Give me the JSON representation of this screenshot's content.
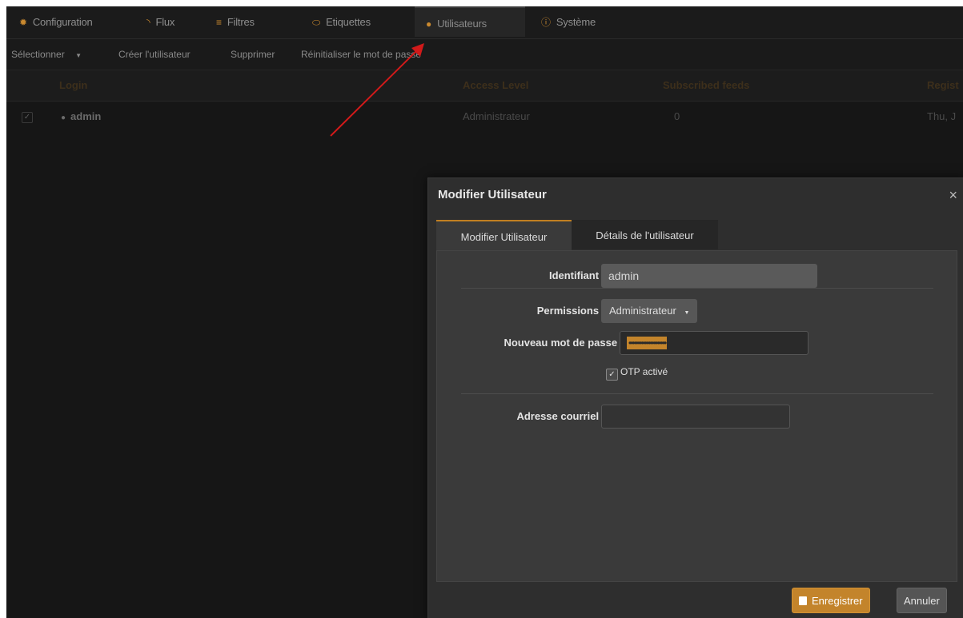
{
  "tabs": [
    {
      "label": "Configuration",
      "icon": "gear-icon"
    },
    {
      "label": "Flux",
      "icon": "rss-icon"
    },
    {
      "label": "Filtres",
      "icon": "filter-icon"
    },
    {
      "label": "Etiquettes",
      "icon": "label-icon"
    },
    {
      "label": "Utilisateurs",
      "icon": "user-icon",
      "active": true
    },
    {
      "label": "Système",
      "icon": "info-icon"
    }
  ],
  "toolbar": {
    "select_label": "Sélectionner",
    "create_label": "Créer l'utilisateur",
    "delete_label": "Supprimer",
    "reset_label": "Réinitialiser le mot de passe"
  },
  "grid": {
    "columns": [
      "Login",
      "Access Level",
      "Subscribed feeds",
      "Regist"
    ],
    "rows": [
      {
        "checkmark": "✓",
        "login": "admin",
        "access_level": "Administrateur",
        "feeds": "0",
        "registered": "Thu, J"
      }
    ]
  },
  "dialog": {
    "title": "Modifier Utilisateur",
    "close_glyph": "×",
    "tabs": [
      "Modifier Utilisateur",
      "Détails de l'utilisateur"
    ],
    "login_label": "Identifiant :",
    "login_value": "admin",
    "permissions_label": "Permissions :",
    "permissions_value": "Administrateur",
    "password_label": "Nouveau mot de passe :",
    "password_mask": "•••••••••••••••••••••",
    "otp_label": "OTP activé",
    "otp_check": "✓",
    "email_label": "Adresse courriel :",
    "email_value": "",
    "save_label": "Enregistrer",
    "cancel_label": "Annuler"
  },
  "colors": {
    "accent": "#c3842b",
    "background": "#161616",
    "dialog": "#2e2e2e",
    "annotation_arrow": "#d11a1a"
  }
}
